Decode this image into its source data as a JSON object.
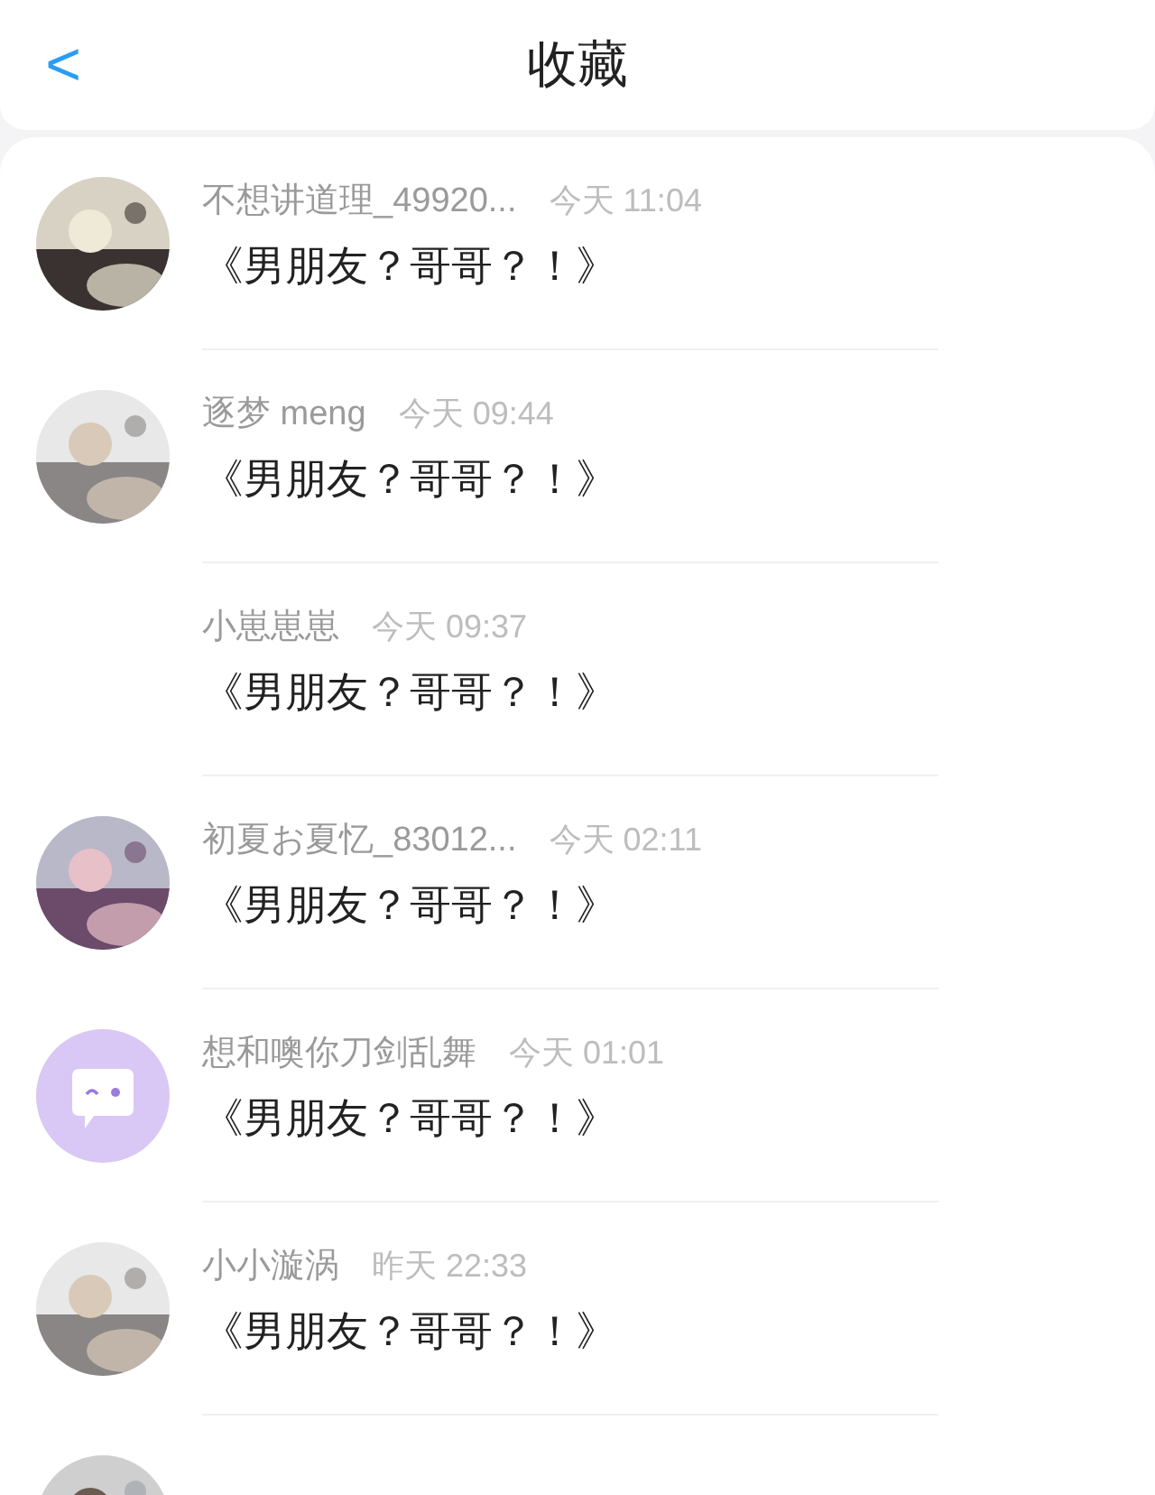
{
  "header": {
    "back": "<",
    "title": "收藏"
  },
  "items": [
    {
      "kind": "picture",
      "name": "不想讲道理_49920...",
      "time": "今天 11:04",
      "title": "《男朋友？哥哥？！》"
    },
    {
      "kind": "picture",
      "name": "逐梦 meng",
      "time": "今天 09:44",
      "title": "《男朋友？哥哥？！》"
    },
    {
      "kind": "blank",
      "name": "小崽崽崽",
      "time": "今天 09:37",
      "title": "《男朋友？哥哥？！》"
    },
    {
      "kind": "picture",
      "name": "初夏お夏忆_83012...",
      "time": "今天 02:11",
      "title": "《男朋友？哥哥？！》"
    },
    {
      "kind": "bubble",
      "name": "想和噢你刀剑乱舞",
      "time": "今天 01:01",
      "title": "《男朋友？哥哥？！》"
    },
    {
      "kind": "picture",
      "name": "小小漩涡",
      "time": "昨天 22:33",
      "title": "《男朋友？哥哥？！》"
    },
    {
      "kind": "picture"
    }
  ]
}
